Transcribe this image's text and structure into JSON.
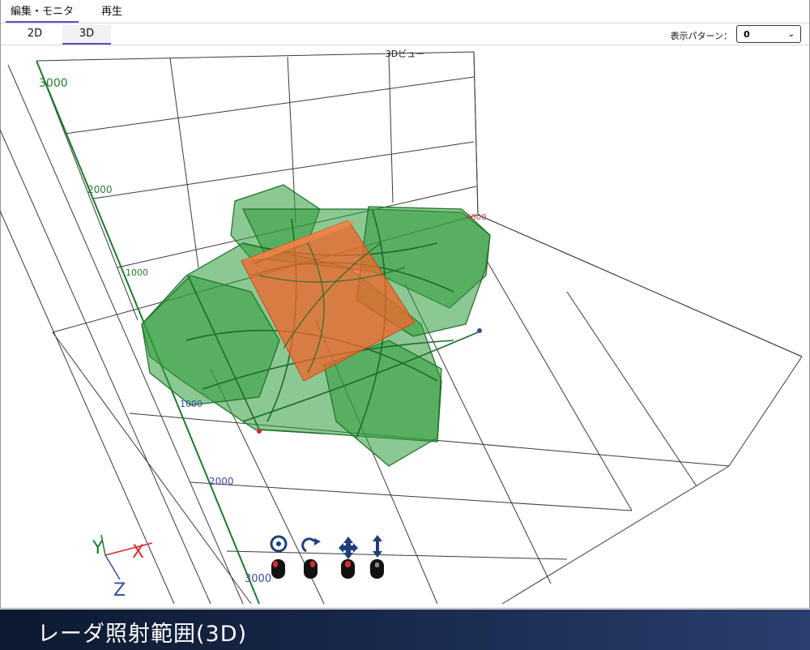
{
  "tabs": {
    "edit_monitor": "編集・モニタ",
    "playback": "再生"
  },
  "view_tabs": {
    "two_d": "2D",
    "three_d": "3D"
  },
  "display_pattern": {
    "label": "表示パターン：",
    "value": "0"
  },
  "view_title": "3Dビュー",
  "axis_labels": {
    "y": [
      "3000",
      "2000",
      "1000"
    ],
    "x": [
      "4000"
    ],
    "z": [
      "1000",
      "2000",
      "3000"
    ]
  },
  "gizmo": {
    "y": "Y",
    "x": "X",
    "z": "Z"
  },
  "controls": [
    "rotate-icon",
    "orbit-icon",
    "pan-icon",
    "zoom-icon"
  ],
  "colors": {
    "radar_fill": "#2e9a3a",
    "target_box": "#f0642a",
    "y_axis": "#1e7a2a",
    "x_axis": "#d42a2a",
    "z_axis": "#3a4aa0"
  },
  "caption": "レーダ照射範囲(3D)"
}
